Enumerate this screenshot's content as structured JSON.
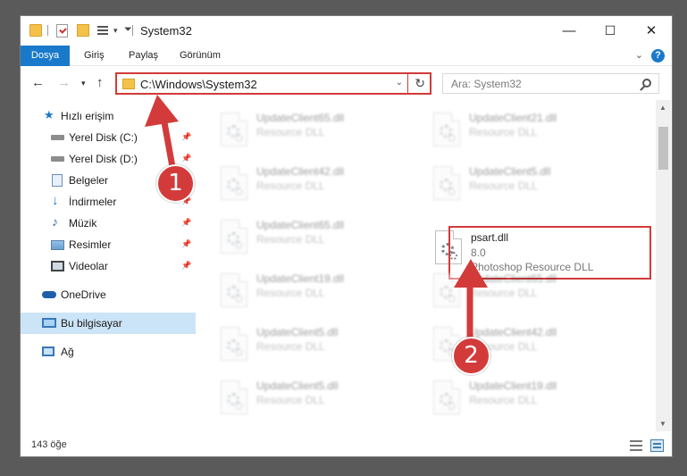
{
  "window": {
    "title": "System32",
    "controls": {
      "minimize": "—",
      "maximize": "☐",
      "close": "✕"
    }
  },
  "ribbon": {
    "tabs": [
      "Dosya",
      "Giriş",
      "Paylaş",
      "Görünüm"
    ],
    "accent": "#1979ca"
  },
  "address": {
    "path": "C:\\Windows\\System32",
    "search_placeholder": "Ara: System32"
  },
  "nav": {
    "items": [
      {
        "label": "Hızlı erişim",
        "icon": "star-icon",
        "pinned": false
      },
      {
        "label": "Yerel Disk (C:)",
        "icon": "drive-icon",
        "pinned": true
      },
      {
        "label": "Yerel Disk (D:)",
        "icon": "drive-icon",
        "pinned": true
      },
      {
        "label": "Belgeler",
        "icon": "documents-icon",
        "pinned": true
      },
      {
        "label": "İndirmeler",
        "icon": "download-icon",
        "pinned": true
      },
      {
        "label": "Müzik",
        "icon": "music-icon",
        "pinned": true
      },
      {
        "label": "Resimler",
        "icon": "pictures-icon",
        "pinned": true
      },
      {
        "label": "Videolar",
        "icon": "video-icon",
        "pinned": true
      },
      {
        "label": "OneDrive",
        "icon": "cloud-icon",
        "pinned": false
      },
      {
        "label": "Bu bilgisayar",
        "icon": "computer-icon",
        "pinned": false,
        "selected": true
      },
      {
        "label": "Ağ",
        "icon": "network-icon",
        "pinned": false
      }
    ]
  },
  "files": [
    {
      "name": "UpdateClient65.dll",
      "desc": "Resource DLL"
    },
    {
      "name": "UpdateClient21.dll",
      "desc": "Resource DLL"
    },
    {
      "name": "UpdateClient42.dll",
      "desc": "Resource DLL"
    },
    {
      "name": "UpdateClient5.dll",
      "desc": "Resource DLL"
    },
    {
      "name": "UpdateClient65.dll",
      "desc": "Resource DLL"
    },
    {
      "name": "psart.dll",
      "version": "8.0",
      "desc": "Photoshop Resource DLL",
      "highlighted": true
    },
    {
      "name": "UpdateClient19.dll",
      "desc": "Resource DLL"
    },
    {
      "name": "UpdateClient65.dll",
      "desc": "Resource DLL"
    },
    {
      "name": "UpdateClient5.dll",
      "desc": "Resource DLL"
    },
    {
      "name": "UpdateClient42.dll",
      "desc": "Resource DLL"
    },
    {
      "name": "UpdateClient5.dll",
      "desc": "Resource DLL"
    },
    {
      "name": "UpdateClient19.dll",
      "desc": "Resource DLL"
    }
  ],
  "status": {
    "item_count": "143 öğe"
  },
  "annotations": {
    "step1": "1",
    "step2": "2",
    "color": "#d33b3b"
  }
}
